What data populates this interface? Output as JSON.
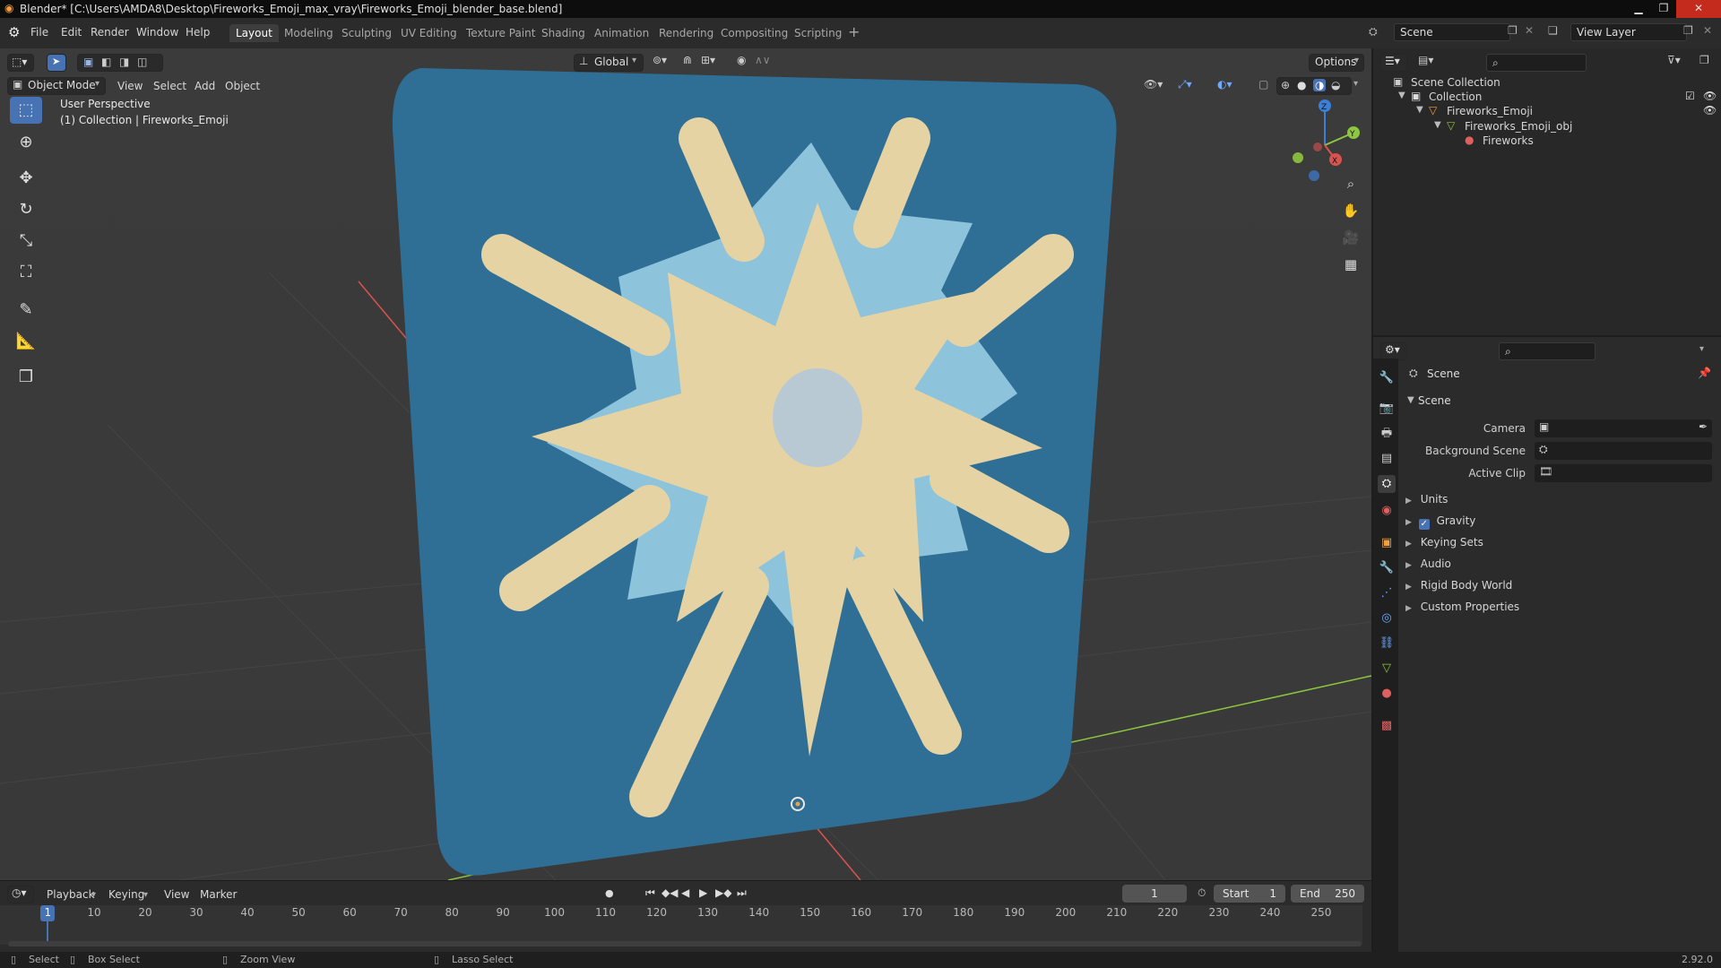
{
  "window": {
    "title": "Blender* [C:\\Users\\AMDA8\\Desktop\\Fireworks_Emoji_max_vray\\Fireworks_Emoji_blender_base.blend]"
  },
  "menu": [
    "File",
    "Edit",
    "Render",
    "Window",
    "Help"
  ],
  "workspaces": [
    "Layout",
    "Modeling",
    "Sculpting",
    "UV Editing",
    "Texture Paint",
    "Shading",
    "Animation",
    "Rendering",
    "Compositing",
    "Scripting"
  ],
  "header": {
    "transform_orientation": "Global",
    "options_label": "Options",
    "scene_name": "Scene",
    "view_layer": "View Layer"
  },
  "viewport": {
    "mode": "Object Mode",
    "menus": [
      "View",
      "Select",
      "Add",
      "Object"
    ],
    "overlay_line1": "User Perspective",
    "overlay_line2": "(1) Collection | Fireworks_Emoji",
    "gizmo": {
      "z": "Z",
      "y": "Y",
      "x": "X"
    },
    "colors": {
      "plate": "#2f6f96",
      "star": "#e6d3a3",
      "halo": "#8ec3dc",
      "x_axis": "#d9534f",
      "y_axis": "#8dc63f",
      "z_axis": "#3c7fd6"
    }
  },
  "outliner": {
    "root": "Scene Collection",
    "collection": "Collection",
    "object": "Fireworks_Emoji",
    "mesh": "Fireworks_Emoji_obj",
    "material": "Fireworks"
  },
  "properties": {
    "context": "Scene",
    "section": "Scene",
    "fields": {
      "camera": "Camera",
      "background_scene": "Background Scene",
      "active_clip": "Active Clip"
    },
    "panels": [
      "Units",
      "Gravity",
      "Keying Sets",
      "Audio",
      "Rigid Body World",
      "Custom Properties"
    ],
    "gravity_checked": true
  },
  "timeline": {
    "menus": [
      "Playback",
      "Keying",
      "View",
      "Marker"
    ],
    "current_frame": "1",
    "start_label": "Start",
    "start": "1",
    "end_label": "End",
    "end": "250",
    "ticks": [
      "1",
      "10",
      "20",
      "30",
      "40",
      "50",
      "60",
      "70",
      "80",
      "90",
      "100",
      "110",
      "120",
      "130",
      "140",
      "150",
      "160",
      "170",
      "180",
      "190",
      "200",
      "210",
      "220",
      "230",
      "240",
      "250"
    ]
  },
  "statusbar": {
    "select": "Select",
    "box_select": "Box Select",
    "zoom_view": "Zoom View",
    "lasso_select": "Lasso Select",
    "version": "2.92.0"
  }
}
